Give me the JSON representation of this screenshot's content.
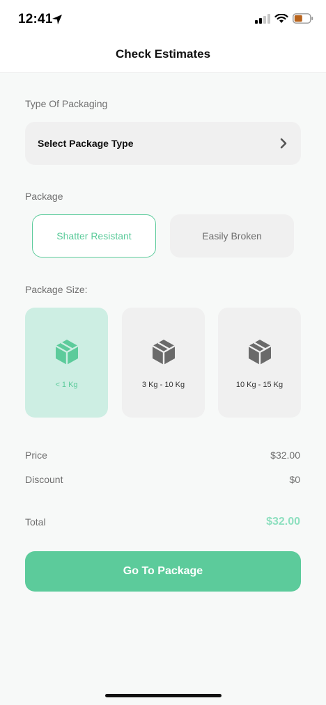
{
  "status": {
    "time": "12:41"
  },
  "header": {
    "title": "Check Estimates"
  },
  "packaging": {
    "label": "Type Of Packaging",
    "select_placeholder": "Select Package Type"
  },
  "package": {
    "label": "Package",
    "options": [
      "Shatter Resistant",
      "Easily Broken"
    ],
    "selected": "Shatter Resistant"
  },
  "size": {
    "label": "Package Size:",
    "options": [
      "< 1 Kg",
      "3 Kg - 10 Kg",
      "10 Kg - 15 Kg"
    ],
    "selected": "< 1 Kg"
  },
  "summary": {
    "price_label": "Price",
    "price_value": "$32.00",
    "discount_label": "Discount",
    "discount_value": "$0",
    "total_label": "Total",
    "total_value": "$32.00"
  },
  "actions": {
    "go_to_package": "Go To Package"
  },
  "colors": {
    "accent": "#5ccb9b",
    "accent_light": "#cdeee3",
    "total": "#8fe0c0"
  },
  "icons": [
    "location-arrow-icon",
    "signal-icon",
    "wifi-icon",
    "battery-icon",
    "chevron-right-icon",
    "package-box-icon"
  ]
}
